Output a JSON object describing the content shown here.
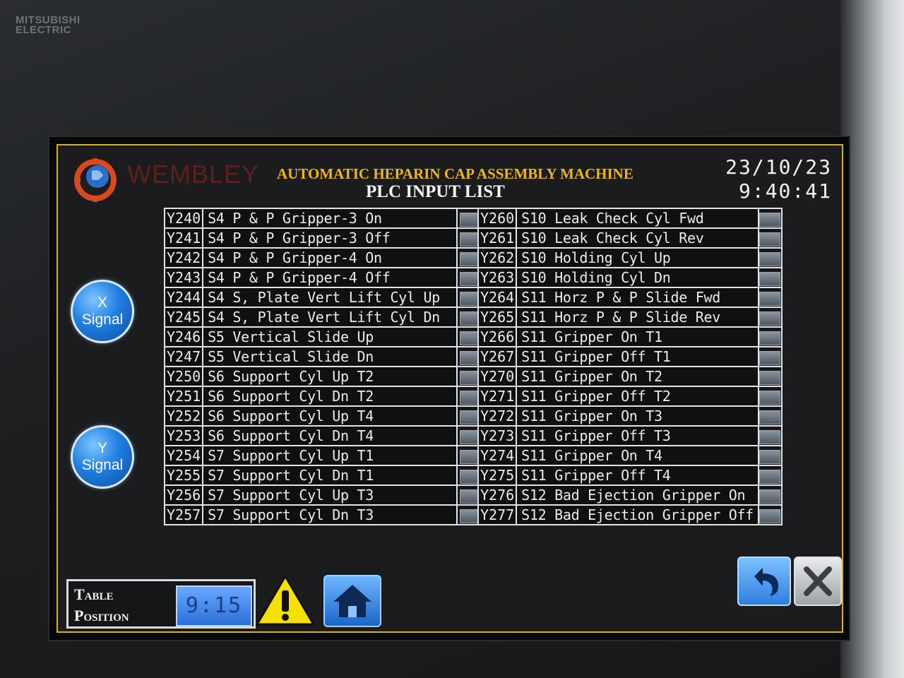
{
  "bezel": {
    "brand": "MITSUBISHI\nELECTRIC"
  },
  "header": {
    "logo_text": "WEMBLEY",
    "title": "AUTOMATIC HEPARIN CAP ASSEMBLY MACHINE",
    "subtitle": "PLC INPUT LIST",
    "date": "23/10/23",
    "time": "9:40:41"
  },
  "buttons": {
    "x_signal": {
      "line1": "X",
      "line2": "Signal"
    },
    "y_signal": {
      "line1": "Y",
      "line2": "Signal"
    }
  },
  "left_list": [
    {
      "addr": "Y240",
      "desc": "S4 P & P Gripper-3 On"
    },
    {
      "addr": "Y241",
      "desc": "S4 P & P Gripper-3 Off"
    },
    {
      "addr": "Y242",
      "desc": "S4 P & P Gripper-4 On"
    },
    {
      "addr": "Y243",
      "desc": "S4 P & P Gripper-4 Off"
    },
    {
      "addr": "Y244",
      "desc": "S4 S, Plate Vert Lift Cyl Up"
    },
    {
      "addr": "Y245",
      "desc": "S4 S, Plate Vert Lift Cyl Dn"
    },
    {
      "addr": "Y246",
      "desc": "S5 Vertical Slide Up"
    },
    {
      "addr": "Y247",
      "desc": "S5 Vertical Slide Dn"
    },
    {
      "addr": "Y250",
      "desc": "S6 Support Cyl Up T2"
    },
    {
      "addr": "Y251",
      "desc": "S6 Support Cyl Dn T2"
    },
    {
      "addr": "Y252",
      "desc": "S6 Support Cyl Up T4"
    },
    {
      "addr": "Y253",
      "desc": "S6 Support Cyl Dn T4"
    },
    {
      "addr": "Y254",
      "desc": "S7 Support Cyl Up T1"
    },
    {
      "addr": "Y255",
      "desc": "S7 Support Cyl Dn T1"
    },
    {
      "addr": "Y256",
      "desc": "S7 Support Cyl Up T3"
    },
    {
      "addr": "Y257",
      "desc": "S7 Support Cyl Dn T3"
    }
  ],
  "right_list": [
    {
      "addr": "Y260",
      "desc": "S10 Leak Check Cyl Fwd"
    },
    {
      "addr": "Y261",
      "desc": "S10 Leak Check Cyl Rev"
    },
    {
      "addr": "Y262",
      "desc": "S10 Holding Cyl Up"
    },
    {
      "addr": "Y263",
      "desc": "S10 Holding Cyl Dn"
    },
    {
      "addr": "Y264",
      "desc": "S11 Horz P & P Slide Fwd"
    },
    {
      "addr": "Y265",
      "desc": "S11 Horz P & P Slide Rev"
    },
    {
      "addr": "Y266",
      "desc": "S11 Gripper On T1"
    },
    {
      "addr": "Y267",
      "desc": "S11 Gripper Off T1"
    },
    {
      "addr": "Y270",
      "desc": "S11 Gripper On T2"
    },
    {
      "addr": "Y271",
      "desc": "S11 Gripper Off T2"
    },
    {
      "addr": "Y272",
      "desc": "S11 Gripper On T3"
    },
    {
      "addr": "Y273",
      "desc": "S11 Gripper Off T3"
    },
    {
      "addr": "Y274",
      "desc": "S11 Gripper On T4"
    },
    {
      "addr": "Y275",
      "desc": "S11 Gripper Off T4"
    },
    {
      "addr": "Y276",
      "desc": "S12 Bad Ejection Gripper On"
    },
    {
      "addr": "Y277",
      "desc": "S12 Bad Ejection Gripper Off"
    }
  ],
  "table_position": {
    "label_line1": "Table",
    "label_line2": "Position",
    "value": "9:15"
  },
  "icons": {
    "warning": "warning-icon",
    "home": "home-icon",
    "back": "back-arrow-icon",
    "close": "close-icon"
  },
  "colors": {
    "frame": "#d8b21a",
    "title": "#f0b41c",
    "button_blue": "#1f7fe0",
    "warning_yellow": "#f5e000"
  }
}
